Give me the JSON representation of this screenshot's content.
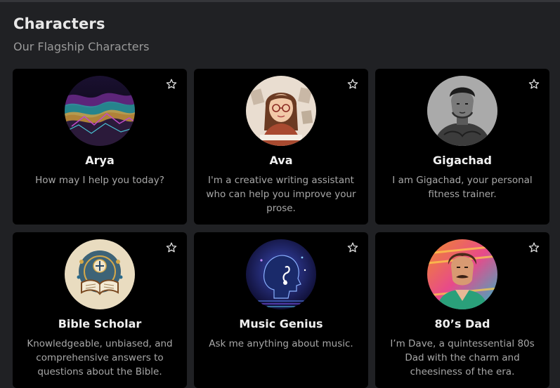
{
  "section": {
    "title": "Characters",
    "subtitle": "Our Flagship Characters"
  },
  "characters": [
    {
      "name": "Arya",
      "description": "How may I help you today?",
      "avatar_icon": "abstract-mountains-avatar"
    },
    {
      "name": "Ava",
      "description": "I'm a creative writing assistant who can help you improve your prose.",
      "avatar_icon": "writer-woman-avatar"
    },
    {
      "name": "Gigachad",
      "description": "I am Gigachad, your personal fitness trainer.",
      "avatar_icon": "muscular-man-avatar"
    },
    {
      "name": "Bible Scholar",
      "description": "Knowledgeable, unbiased, and comprehensive answers to questions about the Bible.",
      "avatar_icon": "open-book-avatar"
    },
    {
      "name": "Music Genius",
      "description": "Ask me anything about music.",
      "avatar_icon": "music-head-avatar"
    },
    {
      "name": "80’s Dad",
      "description": "I’m Dave, a quintessential 80s Dad with the charm and cheesiness of the era.",
      "avatar_icon": "retro-dad-avatar"
    }
  ],
  "favorite_icon": "star-outline-icon",
  "colors": {
    "page_background": "#202124",
    "card_background": "#000000",
    "title_text": "#e8e8e8",
    "subtitle_text": "#9a9a9a",
    "description_text": "#a8a8a8"
  }
}
